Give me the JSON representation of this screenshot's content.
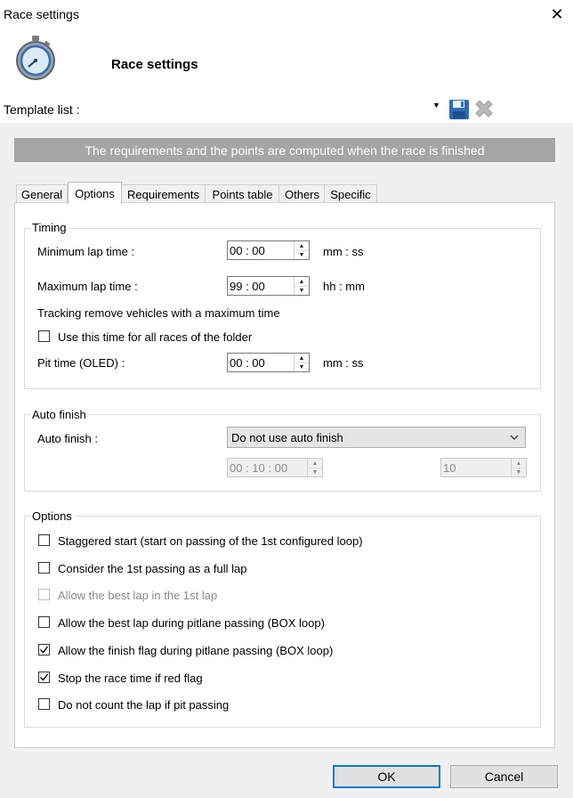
{
  "window": {
    "title": "Race settings",
    "close_glyph": "✕"
  },
  "header": {
    "title": "Race settings",
    "icon": "stopwatch-icon"
  },
  "template": {
    "label": "Template list :",
    "value": "",
    "save_icon": "save-icon",
    "delete_icon": "delete-icon"
  },
  "banner": "The requirements and the points are computed when the race is finished",
  "tabs": [
    "General",
    "Options",
    "Requirements",
    "Points table",
    "Others",
    "Specific"
  ],
  "active_tab": "Options",
  "timing": {
    "title": "Timing",
    "min_lap": {
      "label": "Minimum lap time :",
      "value": "00 : 00",
      "unit": "mm : ss"
    },
    "max_lap": {
      "label": "Maximum lap time :",
      "value": "99 : 00",
      "unit": "hh : mm"
    },
    "tracking_text": "Tracking remove vehicles with a maximum time",
    "use_time": {
      "label": "Use this time for all races of the folder",
      "checked": false
    },
    "pit_time": {
      "label": "Pit time (OLED) :",
      "value": "00 : 00",
      "unit": "mm : ss"
    }
  },
  "auto_finish": {
    "title": "Auto finish",
    "label": "Auto finish :",
    "selected": "Do not use auto finish",
    "time_value": "00 : 10 : 00",
    "count_value": "10"
  },
  "options": {
    "title": "Options",
    "items": [
      {
        "label": "Staggered start (start on passing of the 1st configured loop)",
        "checked": false,
        "enabled": true
      },
      {
        "label": "Consider the 1st passing as a full lap",
        "checked": false,
        "enabled": true
      },
      {
        "label": "Allow the best lap in the 1st lap",
        "checked": false,
        "enabled": false
      },
      {
        "label": "Allow the best lap during pitlane passing (BOX loop)",
        "checked": false,
        "enabled": true
      },
      {
        "label": "Allow the finish flag during pitlane passing (BOX loop)",
        "checked": true,
        "enabled": true
      },
      {
        "label": "Stop the race time if red flag",
        "checked": true,
        "enabled": true
      },
      {
        "label": "Do not count the lap if pit passing",
        "checked": false,
        "enabled": true
      }
    ]
  },
  "buttons": {
    "ok": "OK",
    "cancel": "Cancel"
  }
}
